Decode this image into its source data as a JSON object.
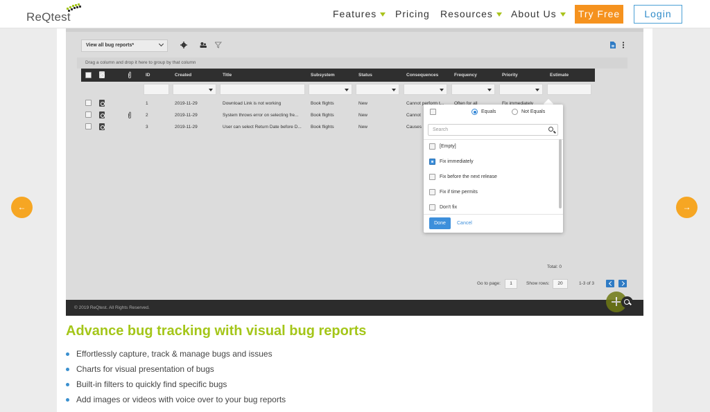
{
  "header": {
    "logo_text": "ReQtest",
    "nav": [
      {
        "label": "Features",
        "has_caret": true
      },
      {
        "label": "Pricing",
        "has_caret": false
      },
      {
        "label": "Resources",
        "has_caret": true
      },
      {
        "label": "About Us",
        "has_caret": true
      }
    ],
    "try_free": "Try Free",
    "login": "Login"
  },
  "app": {
    "view_select": "View all bug reports*",
    "group_hint": "Drag a column and drop it here to group by that column",
    "columns": [
      "ID",
      "Created",
      "Title",
      "Subsystem",
      "Status",
      "Consequences",
      "Frequency",
      "Priority",
      "Estimate"
    ],
    "rows": [
      {
        "id": "1",
        "created": "2019-11-29",
        "title": "Download Link is not working",
        "subsystem": "Book flights",
        "status": "New",
        "consequences": "Cannot perform t...",
        "frequency": "Often for all",
        "priority": "Fix immediately",
        "attachment": false
      },
      {
        "id": "2",
        "created": "2019-11-29",
        "title": "System throws error on selecting fre...",
        "subsystem": "Book flights",
        "status": "New",
        "consequences": "Cannot",
        "frequency": "",
        "priority": "",
        "attachment": true
      },
      {
        "id": "3",
        "created": "2019-11-29",
        "title": "User can select Return Date before D...",
        "subsystem": "Book flights",
        "status": "New",
        "consequences": "Causes",
        "frequency": "",
        "priority": "",
        "attachment": false
      }
    ],
    "total": "Total: 0",
    "go_to_page_label": "Go to page:",
    "page_value": "1",
    "show_rows_label": "Show rows:",
    "rows_value": "20",
    "range": "1-3 of 3",
    "footer": "© 2019 ReQtest. All Rights Reserved."
  },
  "filter_popup": {
    "equals": "Equals",
    "not_equals": "Not Equals",
    "selected_mode": "Equals",
    "search_placeholder": "Search",
    "options": [
      {
        "label": "[Empty]",
        "checked": false
      },
      {
        "label": "Fix immediately",
        "checked": true
      },
      {
        "label": "Fix before the next release",
        "checked": false
      },
      {
        "label": "Fix if time permits",
        "checked": false
      },
      {
        "label": "Don't fix",
        "checked": false
      }
    ],
    "done": "Done",
    "cancel": "Cancel"
  },
  "content": {
    "headline": "Advance bug tracking with visual bug reports",
    "bullets": [
      "Effortlessly capture, track & manage bugs and issues",
      "Charts for visual presentation of bugs",
      "Built-in filters to quickly find specific bugs",
      "Add images or videos with voice over to your bug reports"
    ]
  },
  "colors": {
    "accent_green": "#a4c619",
    "orange": "#f5921e",
    "blue": "#3d8fdb"
  }
}
